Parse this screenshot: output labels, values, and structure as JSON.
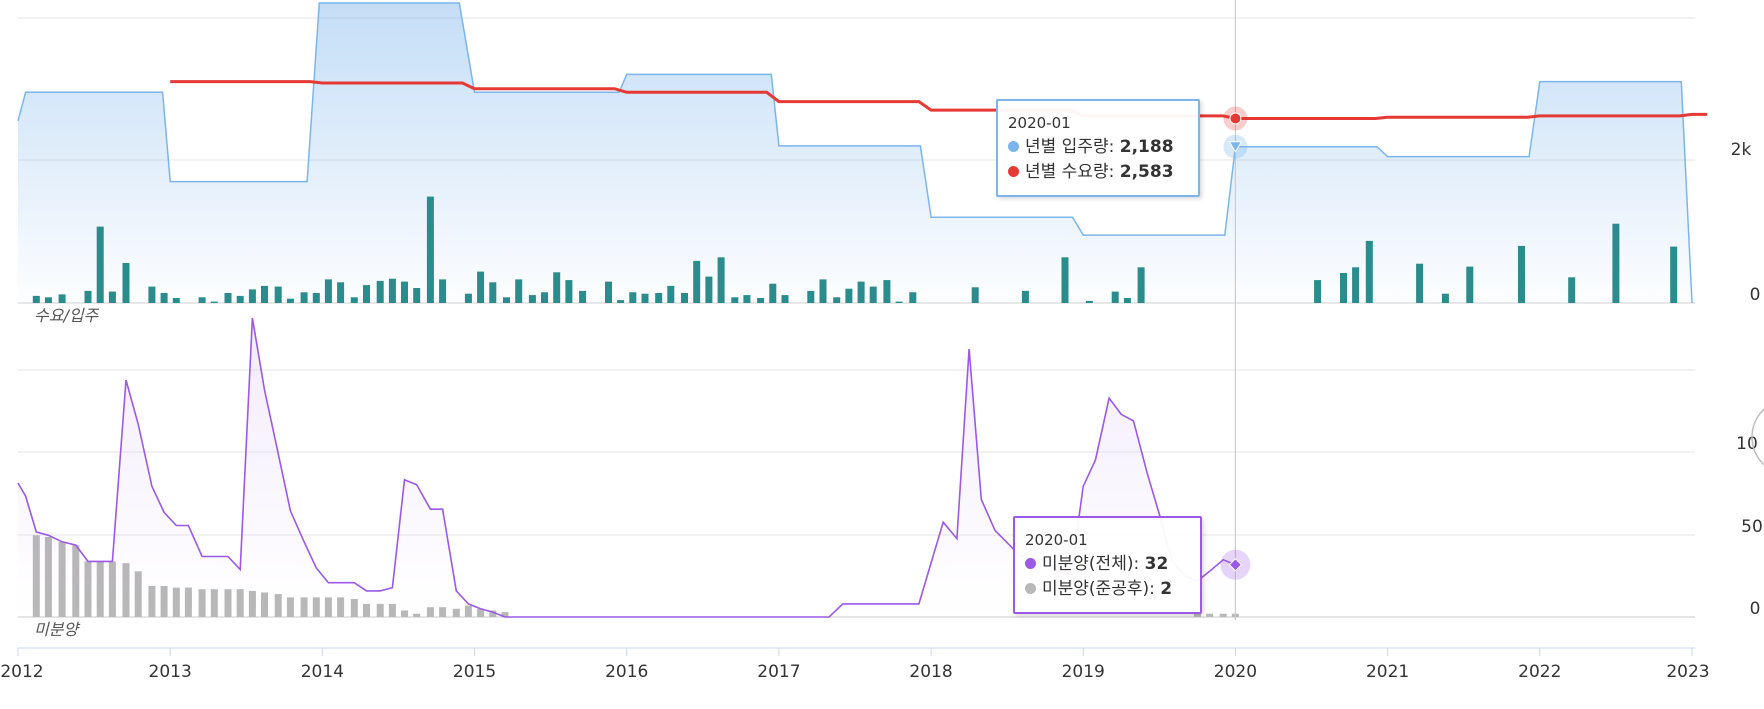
{
  "chart_data": [
    {
      "type": "area",
      "panel_label": "수요/입주",
      "y_ticks": [
        "0",
        "2k"
      ],
      "series": [
        {
          "name": "년별 입주량",
          "kind": "step-area",
          "color": "#7cb5ec",
          "points": [
            [
              2012.0,
              2550
            ],
            [
              2012.05,
              2950
            ],
            [
              2012.95,
              2950
            ],
            [
              2013.0,
              1700
            ],
            [
              2013.9,
              1700
            ],
            [
              2013.98,
              4200
            ],
            [
              2014.9,
              4200
            ],
            [
              2015.0,
              2950
            ],
            [
              2015.95,
              2950
            ],
            [
              2016.0,
              3200
            ],
            [
              2016.95,
              3200
            ],
            [
              2017.0,
              2200
            ],
            [
              2017.93,
              2200
            ],
            [
              2018.0,
              1200
            ],
            [
              2018.93,
              1200
            ],
            [
              2019.0,
              950
            ],
            [
              2019.93,
              950
            ],
            [
              2020.0,
              2188
            ],
            [
              2020.93,
              2188
            ],
            [
              2021.0,
              2050
            ],
            [
              2021.93,
              2050
            ],
            [
              2022.0,
              3100
            ],
            [
              2022.93,
              3100
            ],
            [
              2023.0,
              0
            ]
          ]
        },
        {
          "name": "년별 수요량",
          "kind": "line",
          "color": "#e53935",
          "points": [
            [
              2013.0,
              3100
            ],
            [
              2013.92,
              3100
            ],
            [
              2014.0,
              3080
            ],
            [
              2014.92,
              3080
            ],
            [
              2015.0,
              3000
            ],
            [
              2015.92,
              3000
            ],
            [
              2016.0,
              2950
            ],
            [
              2016.92,
              2950
            ],
            [
              2017.0,
              2820
            ],
            [
              2017.92,
              2820
            ],
            [
              2018.0,
              2700
            ],
            [
              2018.92,
              2700
            ],
            [
              2019.0,
              2620
            ],
            [
              2019.92,
              2620
            ],
            [
              2020.0,
              2583
            ],
            [
              2020.92,
              2583
            ],
            [
              2021.0,
              2600
            ],
            [
              2021.92,
              2600
            ],
            [
              2022.0,
              2620
            ],
            [
              2022.92,
              2620
            ],
            [
              2023.0,
              2640
            ],
            [
              2023.1,
              2640
            ]
          ]
        },
        {
          "name": "월별 입주량",
          "kind": "bar",
          "color": "#2a8c8c",
          "points": [
            [
              2012.12,
              100
            ],
            [
              2012.2,
              80
            ],
            [
              2012.29,
              120
            ],
            [
              2012.46,
              170
            ],
            [
              2012.54,
              1070
            ],
            [
              2012.62,
              160
            ],
            [
              2012.71,
              560
            ],
            [
              2012.88,
              230
            ],
            [
              2012.96,
              140
            ],
            [
              2013.04,
              70
            ],
            [
              2013.21,
              80
            ],
            [
              2013.29,
              20
            ],
            [
              2013.38,
              140
            ],
            [
              2013.46,
              100
            ],
            [
              2013.54,
              190
            ],
            [
              2013.62,
              240
            ],
            [
              2013.71,
              230
            ],
            [
              2013.79,
              60
            ],
            [
              2013.88,
              150
            ],
            [
              2013.96,
              140
            ],
            [
              2014.04,
              330
            ],
            [
              2014.12,
              290
            ],
            [
              2014.21,
              80
            ],
            [
              2014.29,
              250
            ],
            [
              2014.38,
              310
            ],
            [
              2014.46,
              340
            ],
            [
              2014.54,
              300
            ],
            [
              2014.62,
              210
            ],
            [
              2014.71,
              1490
            ],
            [
              2014.79,
              330
            ],
            [
              2014.96,
              130
            ],
            [
              2015.04,
              440
            ],
            [
              2015.12,
              290
            ],
            [
              2015.21,
              80
            ],
            [
              2015.29,
              330
            ],
            [
              2015.38,
              110
            ],
            [
              2015.46,
              150
            ],
            [
              2015.54,
              430
            ],
            [
              2015.62,
              320
            ],
            [
              2015.71,
              170
            ],
            [
              2015.88,
              300
            ],
            [
              2015.96,
              40
            ],
            [
              2016.04,
              150
            ],
            [
              2016.12,
              130
            ],
            [
              2016.21,
              140
            ],
            [
              2016.29,
              240
            ],
            [
              2016.38,
              140
            ],
            [
              2016.46,
              590
            ],
            [
              2016.54,
              370
            ],
            [
              2016.62,
              640
            ],
            [
              2016.71,
              80
            ],
            [
              2016.79,
              110
            ],
            [
              2016.88,
              70
            ],
            [
              2016.96,
              270
            ],
            [
              2017.04,
              110
            ],
            [
              2017.21,
              170
            ],
            [
              2017.29,
              330
            ],
            [
              2017.38,
              80
            ],
            [
              2017.46,
              200
            ],
            [
              2017.54,
              300
            ],
            [
              2017.62,
              230
            ],
            [
              2017.71,
              320
            ],
            [
              2017.79,
              20
            ],
            [
              2017.88,
              150
            ],
            [
              2018.29,
              220
            ],
            [
              2018.62,
              170
            ],
            [
              2018.88,
              640
            ],
            [
              2019.04,
              30
            ],
            [
              2019.21,
              160
            ],
            [
              2019.29,
              70
            ],
            [
              2019.38,
              500
            ],
            [
              2020.54,
              320
            ],
            [
              2020.71,
              420
            ],
            [
              2020.79,
              500
            ],
            [
              2020.88,
              870
            ],
            [
              2021.21,
              550
            ],
            [
              2021.38,
              130
            ],
            [
              2021.54,
              510
            ],
            [
              2021.88,
              800
            ],
            [
              2022.21,
              360
            ],
            [
              2022.5,
              1110
            ],
            [
              2022.88,
              790
            ]
          ]
        }
      ],
      "tooltip": {
        "date": "2020-01",
        "rows": [
          {
            "label": "년별 입주량",
            "value": "2,188",
            "color": "#7cb5ec"
          },
          {
            "label": "년별 수요량",
            "value": "2,583",
            "color": "#e53935"
          }
        ]
      }
    },
    {
      "type": "line",
      "panel_label": "미분양",
      "y_ticks": [
        "0",
        "50",
        "10"
      ],
      "series": [
        {
          "name": "미분양(전체)",
          "kind": "area-line",
          "color": "#9b59e6",
          "points": [
            [
              2012.0,
              82
            ],
            [
              2012.05,
              74
            ],
            [
              2012.12,
              52
            ],
            [
              2012.2,
              50
            ],
            [
              2012.29,
              46
            ],
            [
              2012.38,
              44
            ],
            [
              2012.46,
              34
            ],
            [
              2012.54,
              34
            ],
            [
              2012.62,
              34
            ],
            [
              2012.71,
              145
            ],
            [
              2012.79,
              118
            ],
            [
              2012.88,
              80
            ],
            [
              2012.96,
              64
            ],
            [
              2013.04,
              56
            ],
            [
              2013.12,
              56
            ],
            [
              2013.21,
              37
            ],
            [
              2013.29,
              37
            ],
            [
              2013.38,
              37
            ],
            [
              2013.46,
              29
            ],
            [
              2013.54,
              183
            ],
            [
              2013.62,
              139
            ],
            [
              2013.71,
              100
            ],
            [
              2013.79,
              65
            ],
            [
              2013.88,
              46
            ],
            [
              2013.96,
              30
            ],
            [
              2014.04,
              21
            ],
            [
              2014.12,
              21
            ],
            [
              2014.21,
              21
            ],
            [
              2014.29,
              16
            ],
            [
              2014.38,
              16
            ],
            [
              2014.46,
              18
            ],
            [
              2014.54,
              84
            ],
            [
              2014.62,
              81
            ],
            [
              2014.71,
              66
            ],
            [
              2014.79,
              66
            ],
            [
              2014.88,
              16
            ],
            [
              2014.96,
              8
            ],
            [
              2015.04,
              5
            ],
            [
              2015.12,
              3
            ],
            [
              2015.2,
              0
            ],
            [
              2017.33,
              0
            ],
            [
              2017.42,
              8
            ],
            [
              2017.92,
              8
            ],
            [
              2018.08,
              58
            ],
            [
              2018.17,
              48
            ],
            [
              2018.25,
              164
            ],
            [
              2018.33,
              72
            ],
            [
              2018.42,
              53
            ],
            [
              2018.58,
              38
            ],
            [
              2018.67,
              35
            ],
            [
              2018.75,
              35
            ],
            [
              2018.83,
              28
            ],
            [
              2018.92,
              26
            ],
            [
              2019.0,
              80
            ],
            [
              2019.08,
              96
            ],
            [
              2019.17,
              134
            ],
            [
              2019.25,
              124
            ],
            [
              2019.33,
              120
            ],
            [
              2019.42,
              88
            ],
            [
              2019.5,
              63
            ],
            [
              2019.58,
              35
            ],
            [
              2019.67,
              25
            ],
            [
              2019.75,
              22
            ],
            [
              2019.83,
              28
            ],
            [
              2019.92,
              35
            ],
            [
              2020.0,
              32
            ]
          ]
        },
        {
          "name": "미분양(준공후)",
          "kind": "bar",
          "color": "#b8b8b8",
          "points": [
            [
              2012.12,
              50
            ],
            [
              2012.2,
              49
            ],
            [
              2012.29,
              46
            ],
            [
              2012.38,
              44
            ],
            [
              2012.46,
              34
            ],
            [
              2012.54,
              34
            ],
            [
              2012.62,
              34
            ],
            [
              2012.71,
              33
            ],
            [
              2012.79,
              28
            ],
            [
              2012.88,
              19
            ],
            [
              2012.96,
              19
            ],
            [
              2013.04,
              18
            ],
            [
              2013.12,
              18
            ],
            [
              2013.21,
              17
            ],
            [
              2013.29,
              17
            ],
            [
              2013.38,
              17
            ],
            [
              2013.46,
              17
            ],
            [
              2013.54,
              16
            ],
            [
              2013.62,
              15
            ],
            [
              2013.71,
              14
            ],
            [
              2013.79,
              12
            ],
            [
              2013.88,
              12
            ],
            [
              2013.96,
              12
            ],
            [
              2014.04,
              12
            ],
            [
              2014.12,
              12
            ],
            [
              2014.21,
              11
            ],
            [
              2014.29,
              8
            ],
            [
              2014.38,
              8
            ],
            [
              2014.46,
              8
            ],
            [
              2014.54,
              4
            ],
            [
              2014.62,
              2
            ],
            [
              2014.71,
              6
            ],
            [
              2014.79,
              6
            ],
            [
              2014.88,
              5
            ],
            [
              2014.96,
              7
            ],
            [
              2015.04,
              5
            ],
            [
              2015.12,
              4
            ],
            [
              2015.2,
              3
            ],
            [
              2019.75,
              2
            ],
            [
              2019.83,
              2
            ],
            [
              2019.92,
              2
            ],
            [
              2020.0,
              2
            ]
          ]
        }
      ],
      "tooltip": {
        "date": "2020-01",
        "rows": [
          {
            "label": "미분양(전체)",
            "value": "32",
            "color": "#9b59e6"
          },
          {
            "label": "미분양(준공후)",
            "value": "2",
            "color": "#b8b8b8"
          }
        ]
      }
    }
  ],
  "x_axis": {
    "ticks": [
      "2012",
      "2013",
      "2014",
      "2015",
      "2016",
      "2017",
      "2018",
      "2019",
      "2020",
      "2021",
      "2022",
      "2023"
    ]
  },
  "crosshair_x": "2020-01"
}
